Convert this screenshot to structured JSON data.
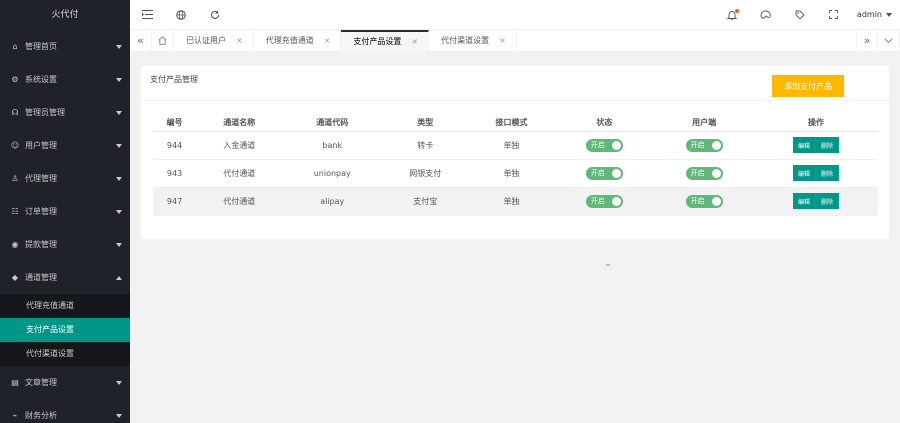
{
  "app": {
    "logo": "火代付"
  },
  "sidebar": {
    "items": [
      {
        "label": "管理首页",
        "icon": "home-icon",
        "symbol": "⌂"
      },
      {
        "label": "系统设置",
        "icon": "gear-icon",
        "symbol": "⚙"
      },
      {
        "label": "管理员管理",
        "icon": "headset-icon",
        "symbol": "☊"
      },
      {
        "label": "用户管理",
        "icon": "user-icon",
        "symbol": "☺"
      },
      {
        "label": "代理管理",
        "icon": "agent-icon",
        "symbol": "♙"
      },
      {
        "label": "订单管理",
        "icon": "order-icon",
        "symbol": "☷"
      },
      {
        "label": "提款管理",
        "icon": "withdraw-icon",
        "symbol": "◉"
      },
      {
        "label": "通道管理",
        "icon": "diamond-icon",
        "symbol": "◆"
      }
    ],
    "submenu": [
      {
        "label": "代理充值通道"
      },
      {
        "label": "支付产品设置"
      },
      {
        "label": "代付渠道设置"
      }
    ],
    "bottom_items": [
      {
        "label": "文章管理",
        "icon": "article-icon",
        "symbol": "▤"
      },
      {
        "label": "财务分析",
        "icon": "chart-icon",
        "symbol": "⌁"
      }
    ]
  },
  "header": {
    "icons": {
      "menu": "menu-fold-icon",
      "globe": "globe-icon",
      "refresh": "refresh-icon",
      "bell": "bell-icon",
      "theme": "palette-icon",
      "note": "tag-icon",
      "fullscreen": "fullscreen-icon"
    },
    "user": "admin"
  },
  "tabs": [
    {
      "label": "已认证用户",
      "active": false
    },
    {
      "label": "代理充值通道",
      "active": false
    },
    {
      "label": "支付产品设置",
      "active": true
    },
    {
      "label": "代付渠道设置",
      "active": false
    }
  ],
  "card": {
    "title": "支付产品管理",
    "add_button": "添加支付产品"
  },
  "table": {
    "columns": [
      "编号",
      "通道名称",
      "通道代码",
      "类型",
      "接口模式",
      "状态",
      "用户端",
      "操作"
    ],
    "rows": [
      {
        "id": "944",
        "name": "入金通道",
        "code": "bank",
        "type": "转卡",
        "mode": "单独",
        "status": "开启",
        "client": "开启",
        "edit": "编辑",
        "delete": "删除"
      },
      {
        "id": "943",
        "name": "代付通道",
        "code": "unionpay",
        "type": "网银支付",
        "mode": "单独",
        "status": "开启",
        "client": "开启",
        "edit": "编辑",
        "delete": "删除"
      },
      {
        "id": "947",
        "name": "代付通道",
        "code": "alipay",
        "type": "支付宝",
        "mode": "单独",
        "status": "开启",
        "client": "开启",
        "edit": "编辑",
        "delete": "删除"
      }
    ]
  },
  "colors": {
    "sidebar_bg": "#20222a",
    "accent": "#009688",
    "warning": "#ffb800",
    "switch_on": "#5fb878"
  }
}
